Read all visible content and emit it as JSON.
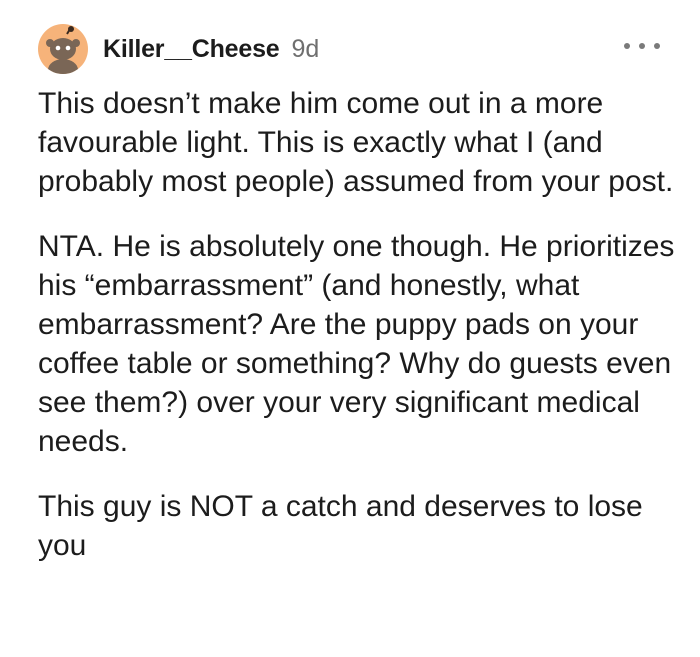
{
  "comment": {
    "author": "Killer__Cheese",
    "age": "9d",
    "avatar_icon": "snoo-avatar-icon",
    "avatar_color": "#f6b37a",
    "more_icon": "more-options-icon",
    "paragraphs": [
      "This doesn’t make him come out in a more favourable light. This is exactly what I (and probably most people) assumed from your post.",
      "NTA. He is absolutely one though. He prioritizes his “embarrassment” (and honestly, what embarrassment? Are the puppy pads on your coffee table or something? Why do guests even see them?) over your very significant medical needs.",
      "This guy is NOT a catch and deserves to lose you"
    ]
  }
}
